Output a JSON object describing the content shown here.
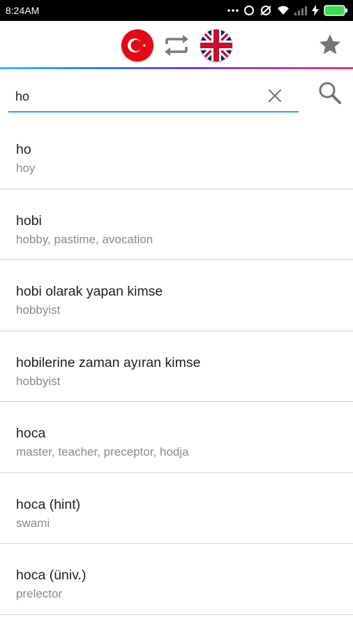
{
  "status_bar": {
    "time": "8:24AM",
    "icons": [
      "more-dots-icon",
      "ring-icon",
      "sync-off-icon",
      "wifi-icon",
      "signal-icon",
      "charging-icon",
      "battery-icon"
    ]
  },
  "header": {
    "source_flag": "turkey-flag-icon",
    "swap": "swap-arrows-icon",
    "target_flag": "uk-flag-icon",
    "favorites": "star-icon"
  },
  "search": {
    "value": "ho",
    "clear_icon": "close-icon",
    "search_icon": "search-icon"
  },
  "results": [
    {
      "term": "ho",
      "translation": "hoy"
    },
    {
      "term": "hobi",
      "translation": "hobby, pastime, avocation"
    },
    {
      "term": "hobi olarak yapan kimse",
      "translation": "hobbyist"
    },
    {
      "term": "hobilerine zaman ayıran kimse",
      "translation": "hobbyist"
    },
    {
      "term": "hoca",
      "translation": "master, teacher, preceptor, hodja"
    },
    {
      "term": "hoca (hint)",
      "translation": "swami"
    },
    {
      "term": "hoca (üniv.)",
      "translation": "prelector"
    }
  ],
  "colors": {
    "accent": "#2aa3d6",
    "divider": "#cfcfcf",
    "term_text": "#212121",
    "translation_text": "#8a8a8a",
    "icon_gray": "#757575"
  }
}
